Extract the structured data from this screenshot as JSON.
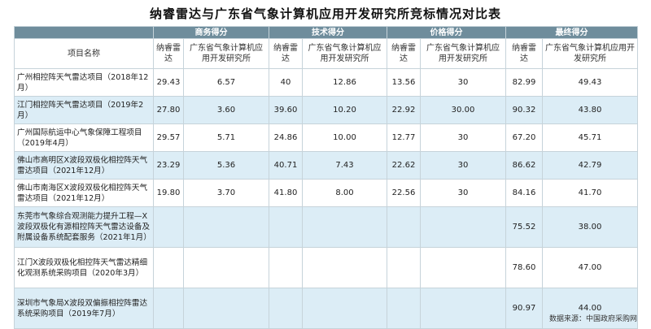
{
  "title": "纳睿雷达与广东省气象计算机应用开发研究所竞标情况对比表",
  "header": {
    "project_col": "项目名称",
    "groups": [
      "商务得分",
      "技术得分",
      "价格得分",
      "最终得分"
    ],
    "sub_a": "纳睿雷达",
    "sub_b": "广东省气象计算机应用开发研究所"
  },
  "rows": [
    {
      "name": "广州相控阵天气雷达项目（2018年12月）",
      "c": [
        "29.43",
        "6.57",
        "40",
        "12.86",
        "13.56",
        "30",
        "82.99",
        "49.43"
      ]
    },
    {
      "name": "江门相控阵天气雷达项目（2019年2月）",
      "c": [
        "27.80",
        "3.60",
        "39.60",
        "10.20",
        "22.92",
        "30.00",
        "90.32",
        "43.80"
      ]
    },
    {
      "name": "广州国际航运中心气象保障工程项目（2019年4月）",
      "c": [
        "29.57",
        "5.71",
        "24.86",
        "10.00",
        "12.77",
        "30",
        "67.20",
        "45.71"
      ]
    },
    {
      "name": "佛山市高明区X波段双极化相控阵天气雷达项目（2021年12月）",
      "c": [
        "23.29",
        "5.36",
        "40.71",
        "7.43",
        "22.62",
        "30",
        "86.62",
        "42.79"
      ]
    },
    {
      "name": "佛山市南海区X波段双极化相控阵天气雷达项目（2021年12月）",
      "c": [
        "19.80",
        "3.70",
        "41.80",
        "8.00",
        "22.56",
        "30",
        "84.16",
        "41.70"
      ]
    },
    {
      "name": "东莞市气象综合观测能力提升工程—X波段双极化有源相控阵天气雷达设备及附属设备系统配套服务（2021年1月）",
      "c": [
        "",
        "",
        "",
        "",
        "",
        "",
        "75.52",
        "38.00"
      ]
    },
    {
      "name": "江门X波段双极化相控阵天气雷达精细化观测系统采购项目（2020年3月）",
      "c": [
        "",
        "",
        "",
        "",
        "",
        "",
        "78.60",
        "47.00"
      ]
    },
    {
      "name": "深圳市气象局X波段双偏振相控阵雷达系统采购项目（2019年7月）",
      "c": [
        "",
        "",
        "",
        "",
        "",
        "",
        "90.97",
        "44.00"
      ]
    }
  ],
  "source": "数据来源：中国政府采购网"
}
